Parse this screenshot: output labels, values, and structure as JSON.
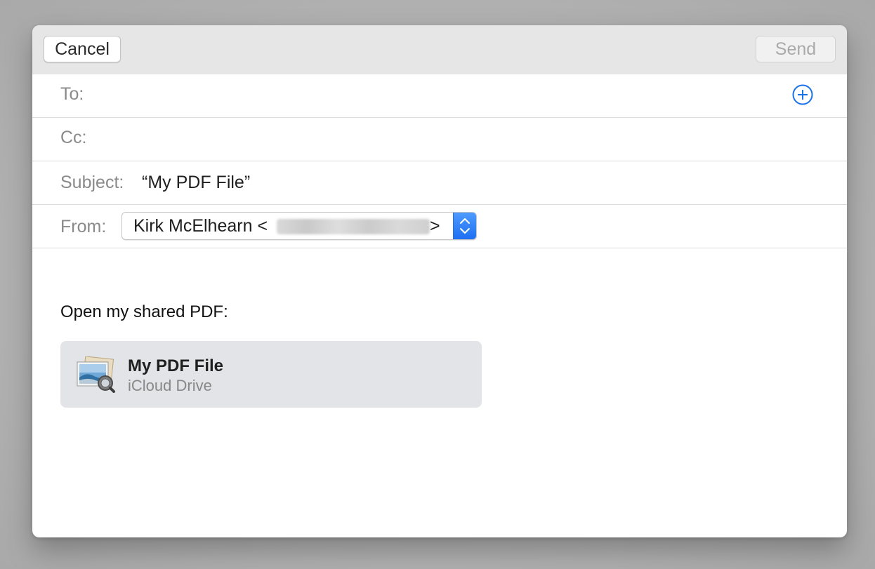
{
  "toolbar": {
    "cancel_label": "Cancel",
    "send_label": "Send"
  },
  "fields": {
    "to_label": "To:",
    "cc_label": "Cc:",
    "subject_label": "Subject:",
    "subject_value": "“My PDF File”",
    "from_label": "From:",
    "from_name": "Kirk McElhearn <",
    "from_close": ">"
  },
  "body": {
    "text": "Open my shared PDF:"
  },
  "attachment": {
    "title": "My PDF File",
    "location": "iCloud Drive",
    "icon": "preview-app-icon"
  },
  "colors": {
    "accent": "#1a73e8",
    "toolbar_bg": "#e6e6e6",
    "attachment_bg": "#e3e4e8"
  }
}
